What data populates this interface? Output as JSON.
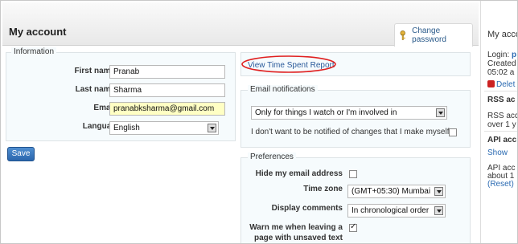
{
  "header": {
    "title": "My account",
    "change_password": "Change password"
  },
  "information": {
    "legend": "Information",
    "first_name_label": "First name",
    "first_name_value": "Pranab",
    "last_name_label": "Last name",
    "last_name_value": "Sharma",
    "email_label": "Email",
    "email_value": "pranabksharma@gmail.com",
    "language_label": "Language",
    "language_value": "English",
    "required_mark": "*"
  },
  "save_label": "Save",
  "report_link": "View Time Spent Report",
  "email_notifications": {
    "legend": "Email notifications",
    "option_value": "Only for things I watch or I'm involved in",
    "self_changes_label": "I don't want to be notified of changes that I make myself",
    "self_changes_checked": false
  },
  "preferences": {
    "legend": "Preferences",
    "hide_email_label": "Hide my email address",
    "hide_email_checked": false,
    "time_zone_label": "Time zone",
    "time_zone_value": "(GMT+05:30) Mumbai",
    "display_comments_label": "Display comments",
    "display_comments_value": "In chronological order",
    "warn_label_1": "Warn me when leaving a",
    "warn_label_2": "page with unsaved text",
    "warn_checked": true
  },
  "sidebar": {
    "title": "My acco",
    "login_label": "Login:",
    "login_value": "p",
    "created": "Created",
    "created_time": "05:02 a",
    "delete": "Delet",
    "rss_heading": "RSS ac",
    "rss_line1": "RSS acc",
    "rss_line2": "over 1 y",
    "api_heading": "API acc",
    "show": "Show",
    "api_line1": "API acc",
    "api_line2": "about 1",
    "reset": "(Reset)"
  },
  "colors": {
    "accent_blue": "#2a66ad",
    "link": "#2a5a9a",
    "highlight": "#ffffc4",
    "annotation_red": "#e02020"
  }
}
